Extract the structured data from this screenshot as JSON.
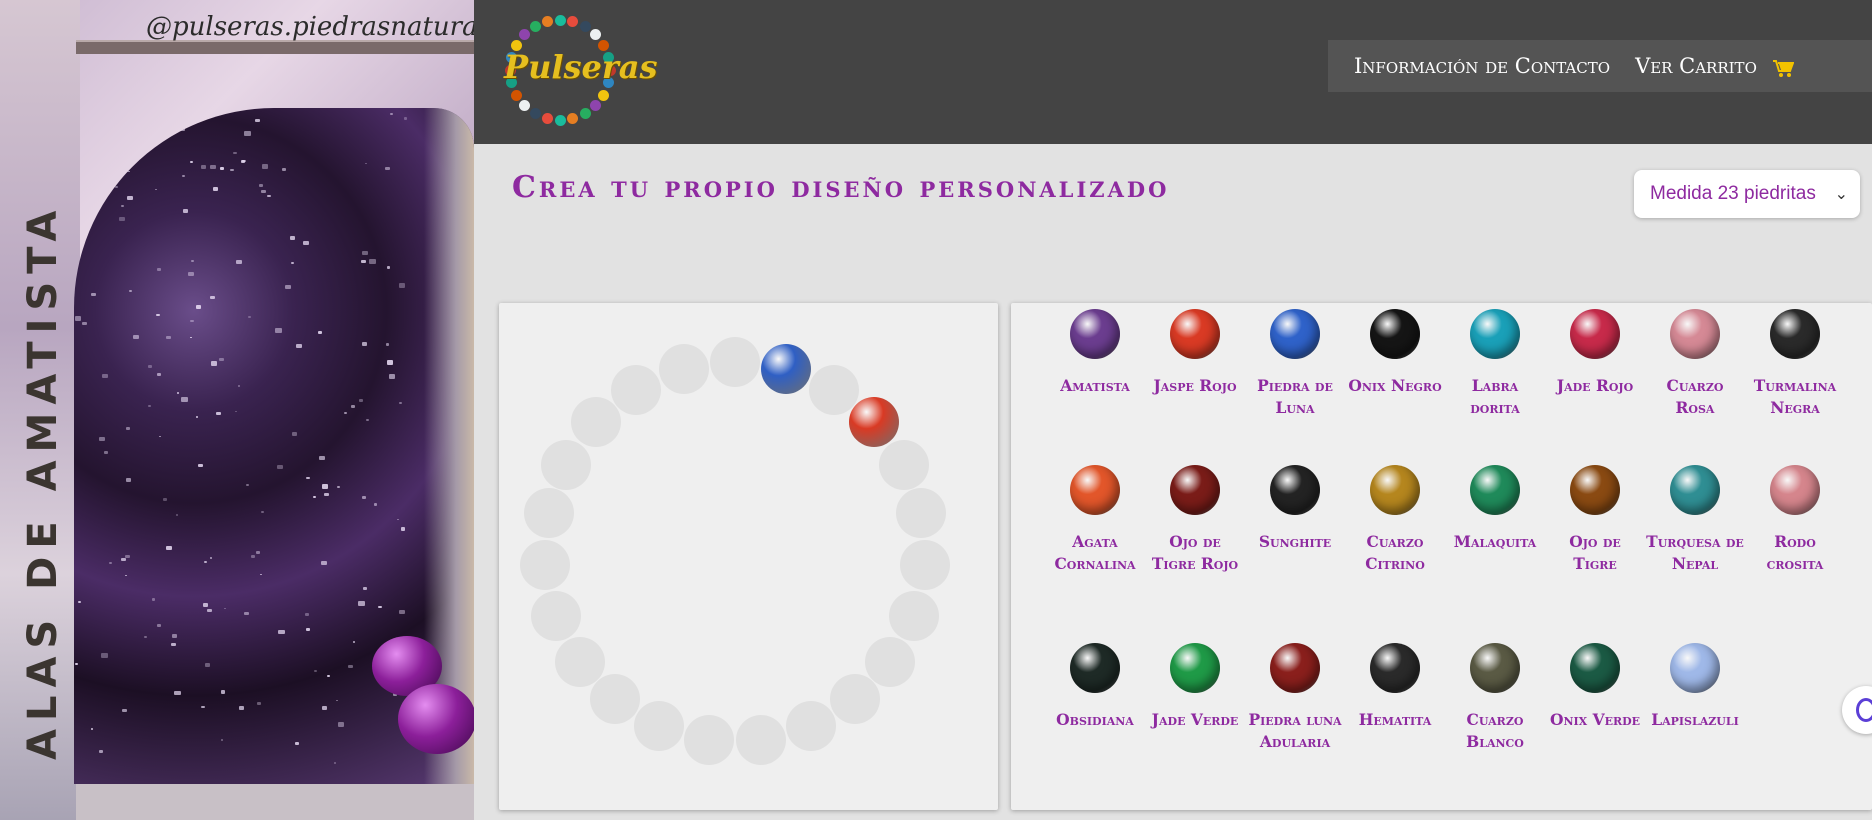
{
  "banner": {
    "handle": "@pulseras.piedrasnaturales",
    "vertical_title": "ALAS DE AMATISTA"
  },
  "header": {
    "logo_text": "Pulseras",
    "nav": [
      {
        "label": "Información de Contacto"
      },
      {
        "label": "Ver Carrito"
      }
    ]
  },
  "main": {
    "title": "Crea tu propio diseño personalizado",
    "size_select": {
      "value": "Medida 23 piedritas"
    }
  },
  "bracelet": {
    "selected": [
      {
        "stone": "Lapislazuli"
      },
      {
        "stone": "Jaspe Rojo"
      }
    ]
  },
  "stones": [
    {
      "label": "Amatista",
      "color": "#6b3d8f"
    },
    {
      "label": "Jaspe Rojo",
      "color": "#d93a24"
    },
    {
      "label": "Piedra de Luna",
      "color": "#2f62c9"
    },
    {
      "label": "Onix Negro",
      "color": "#151515"
    },
    {
      "label": "Labra dorita",
      "color": "#1aa0b8"
    },
    {
      "label": "Jade Rojo",
      "color": "#c72a4a"
    },
    {
      "label": "Cuarzo Rosa",
      "color": "#d58995"
    },
    {
      "label": "Turmalina Negra",
      "color": "#2a2a2a"
    },
    {
      "label": "Agata Cornalina",
      "color": "#e2562a"
    },
    {
      "label": "Ojo de Tigre Rojo",
      "color": "#7a1c18"
    },
    {
      "label": "Sunghite",
      "color": "#232323"
    },
    {
      "label": "Cuarzo Citrino",
      "color": "#b5861e"
    },
    {
      "label": "Malaquita",
      "color": "#1f8a5a"
    },
    {
      "label": "Ojo de Tigre",
      "color": "#8a4a12"
    },
    {
      "label": "Turquesa de Nepal",
      "color": "#2f8e93"
    },
    {
      "label": "Rodo crosita",
      "color": "#d5858c"
    },
    {
      "label": "Obsidiana",
      "color": "#1e2a26"
    },
    {
      "label": "Jade Verde",
      "color": "#1f9a47"
    },
    {
      "label": "Piedra luna Adularia",
      "color": "#8a1f1c"
    },
    {
      "label": "Hematita",
      "color": "#2a2a2a"
    },
    {
      "label": "Cuarzo Blanco",
      "color": "#5a5a44"
    },
    {
      "label": "Onix Verde",
      "color": "#1b5a44"
    },
    {
      "label": "Lapislazuli",
      "color": "#9fb8e8"
    }
  ],
  "colors": {
    "accent": "#8e2aa0",
    "header_bg": "#444444",
    "nav_bg": "#545454",
    "slot": "#e0e0e0"
  },
  "icons": {
    "cart": "shopping-cart-icon",
    "select": "chevron-down-icon",
    "help": "help-fab-icon"
  }
}
